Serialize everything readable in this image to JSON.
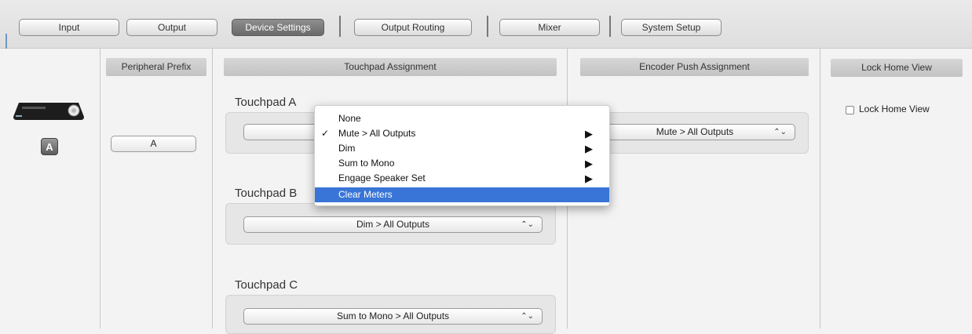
{
  "tabs": [
    {
      "label": "Input",
      "active": false
    },
    {
      "label": "Output",
      "active": false
    },
    {
      "label": "Device Settings",
      "active": true
    },
    {
      "label": "Output Routing",
      "active": false
    },
    {
      "label": "Mixer",
      "active": false
    },
    {
      "label": "System Setup",
      "active": false
    }
  ],
  "peripheral": {
    "header": "Peripheral Prefix",
    "value": "A",
    "badge": "A"
  },
  "touchpad": {
    "header": "Touchpad Assignment",
    "groups": [
      {
        "label": "Touchpad A",
        "value": ""
      },
      {
        "label": "Touchpad B",
        "value": "Dim > All Outputs"
      },
      {
        "label": "Touchpad C",
        "value": "Sum to Mono > All Outputs"
      }
    ]
  },
  "encoder": {
    "header": "Encoder Push Assignment",
    "value": "Mute > All Outputs"
  },
  "lock": {
    "header": "Lock Home View",
    "checkbox_label": "Lock Home View",
    "checked": false
  },
  "menu": {
    "items": [
      {
        "label": "None",
        "checked": false,
        "submenu": false,
        "highlighted": false
      },
      {
        "label": "Mute > All Outputs",
        "checked": true,
        "submenu": true,
        "highlighted": false
      },
      {
        "label": "Dim",
        "checked": false,
        "submenu": true,
        "highlighted": false
      },
      {
        "label": "Sum to Mono",
        "checked": false,
        "submenu": true,
        "highlighted": false
      },
      {
        "label": "Engage Speaker Set",
        "checked": false,
        "submenu": true,
        "highlighted": false
      },
      {
        "label": "Clear Meters",
        "checked": false,
        "submenu": false,
        "highlighted": true
      }
    ],
    "check_glyph": "✓",
    "submenu_glyph": "▶"
  },
  "icons": {
    "popup_arrows": "⌃⌄"
  },
  "colors": {
    "highlight": "#3875d7",
    "active_tab": "#7a7a7a"
  }
}
